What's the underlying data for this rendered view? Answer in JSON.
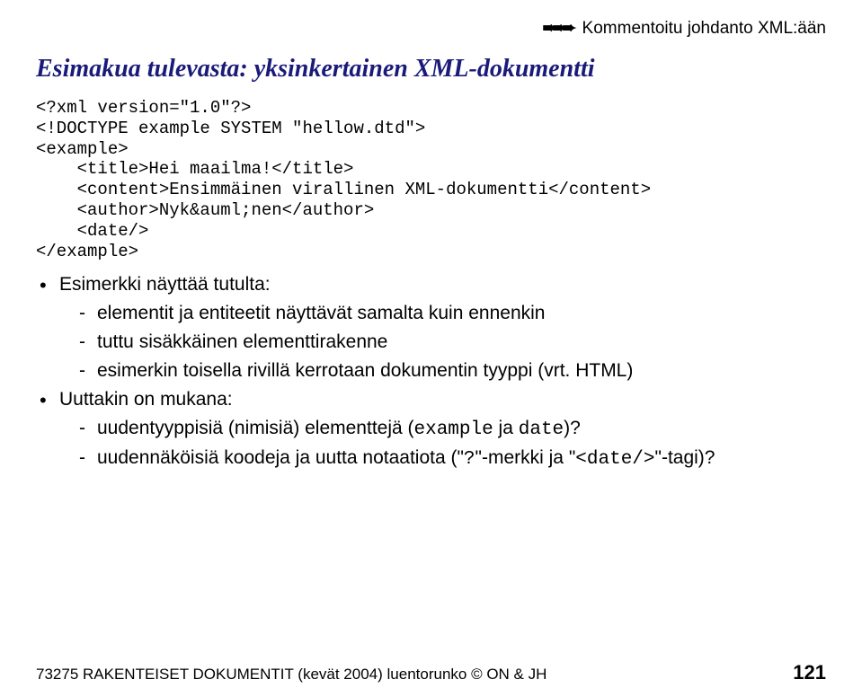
{
  "header": {
    "arrows": "➨➨➨",
    "text": "Kommentoitu johdanto XML:ään"
  },
  "heading": "Esimakua tulevasta: yksinkertainen XML-dokumentti",
  "code": "<?xml version=\"1.0\"?>\n<!DOCTYPE example SYSTEM \"hellow.dtd\">\n<example>\n    <title>Hei maailma!</title>\n    <content>Ensimmäinen virallinen XML-dokumentti</content>\n    <author>Nyk&auml;nen</author>\n    <date/>\n</example>",
  "b1": "Esimerkki näyttää tutulta:",
  "b1a": "elementit ja entiteetit näyttävät samalta kuin ennenkin",
  "b1b": "tuttu sisäkkäinen elementtirakenne",
  "b1c": "esimerkin toisella rivillä kerrotaan dokumentin tyyppi (vrt. HTML)",
  "b2": "Uuttakin on mukana:",
  "b2a_pre": "uudentyyppisiä (nimisiä) elementtejä (",
  "b2a_m1": "example",
  "b2a_mid": " ja ",
  "b2a_m2": "date",
  "b2a_post": ")?",
  "b2b_pre": "uudennäköisiä koodeja ja uutta notaatiota (\"",
  "b2b_m1": "?",
  "b2b_mid": "\"-merkki ja \"",
  "b2b_m2": "<date/>",
  "b2b_post": "\"-tagi)?",
  "footer": {
    "left": "73275 RAKENTEISET DOKUMENTIT (kevät 2004) luentorunko © ON & JH",
    "page": "121"
  }
}
